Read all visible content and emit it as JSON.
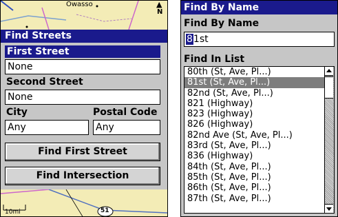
{
  "left_panel": {
    "map_top_label": "Owasso",
    "north_indicator": "N",
    "map_scale": "10mi",
    "map_marker": "51",
    "title": "Find Streets",
    "first_street_label": "First Street",
    "first_street_value": "None",
    "second_street_label": "Second Street",
    "second_street_value": "None",
    "city_label": "City",
    "city_value": "Any",
    "postal_code_label": "Postal Code",
    "postal_code_value": "Any",
    "find_first_street_button": "Find First Street",
    "find_intersection_button": "Find Intersection"
  },
  "right_panel": {
    "title": "Find By Name",
    "find_by_name_label": "Find By Name",
    "search_cursor_char": "8",
    "search_rest": "1st",
    "find_in_list_label": "Find In List",
    "list_items": [
      "80th (St, Ave, Pl...)",
      "81st (St, Ave, Pl...)",
      "82nd (St, Ave, Pl...)",
      "821 (Highway)",
      "823 (Highway)",
      "826 (Highway)",
      "82nd Ave (St, Ave, Pl...)",
      "83rd (St, Ave, Pl...)",
      "836 (Highway)",
      "84th (St, Ave, Pl...)",
      "85th (St, Ave, Pl...)",
      "86th (St, Ave, Pl...)",
      "87th (St, Ave, Pl...)"
    ],
    "selected_index": 1
  },
  "colors": {
    "title_bar": "#1a1a8c",
    "dialog_bg": "#c6c6c6",
    "map_bg": "#f3ecb6",
    "selection": "#7d7d7d"
  }
}
